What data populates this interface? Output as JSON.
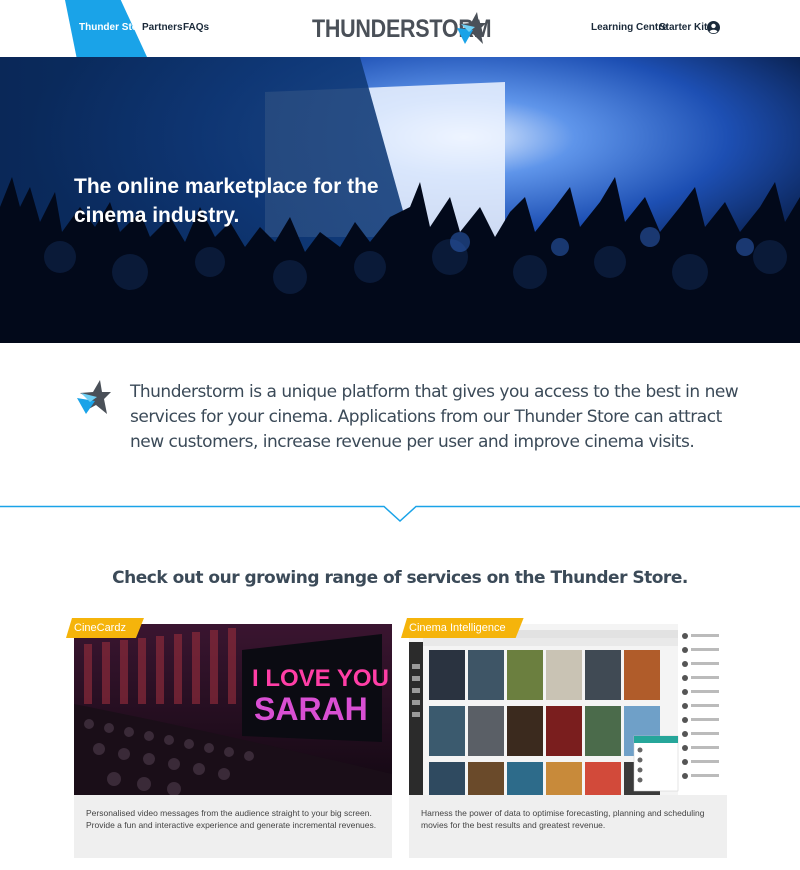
{
  "header": {
    "nav_left": [
      {
        "label": "Thunder Store",
        "active": true
      },
      {
        "label": "Partners",
        "active": false
      },
      {
        "label": "FAQs",
        "active": false
      }
    ],
    "logo_text": "THUNDERSTORM",
    "nav_right": [
      {
        "label": "Learning Centre"
      },
      {
        "label": "Starter Kit"
      }
    ],
    "user_icon": "user-circle-icon"
  },
  "hero": {
    "title": "The online marketplace for the cinema industry."
  },
  "intro": {
    "icon": "thunderstorm-star-icon",
    "text": "Thunderstorm is a unique platform that gives you access to the best in new services for your cinema. Applications from our Thunder Store can attract new customers, increase revenue per user and improve cinema visits."
  },
  "services": {
    "heading": "Check out our growing range of services on the Thunder Store.",
    "cards": [
      {
        "tag": "CineCardz",
        "screen_text_line1": "I LOVE YOU",
        "screen_text_line2": "SARAH",
        "description": "Personalised video messages from the audience straight to your big screen. Provide a fun and interactive experience and generate incremental revenues."
      },
      {
        "tag": "Cinema Intelligence",
        "description": "Harness the power of data to optimise forecasting, planning and scheduling movies for the best results and greatest revenue."
      }
    ]
  },
  "colors": {
    "accent": "#1aa3e8",
    "tag": "#f5b40b",
    "logo": "#4a5058",
    "hero_dark": "#04152e"
  }
}
